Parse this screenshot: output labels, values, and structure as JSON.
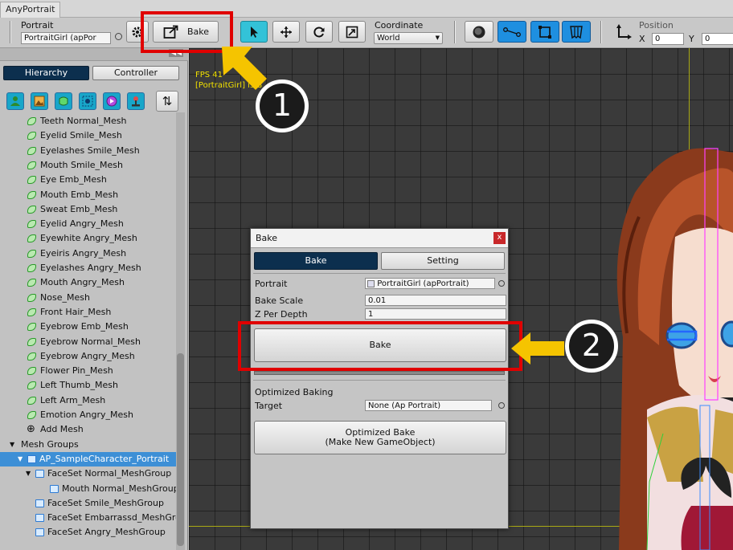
{
  "window": {
    "tab": "AnyPortrait"
  },
  "toolbar": {
    "portrait_label": "Portrait",
    "portrait_value": "PortraitGirl (apPor",
    "bake_label": "Bake",
    "coordinate_label": "Coordinate",
    "coordinate_value": "World",
    "position_label": "Position",
    "x_label": "X",
    "x_value": "0",
    "y_label": "Y",
    "y_value": "0"
  },
  "left_panel": {
    "collapse_glyph": "◀◀",
    "tabs": {
      "hierarchy": "Hierarchy",
      "controller": "Controller"
    },
    "sort_glyph": "⇅",
    "meshes": [
      "Teeth Normal_Mesh",
      "Eyelid Smile_Mesh",
      "Eyelashes Smile_Mesh",
      "Mouth Smile_Mesh",
      "Eye Emb_Mesh",
      "Mouth Emb_Mesh",
      "Sweat Emb_Mesh",
      "Eyelid Angry_Mesh",
      "Eyewhite Angry_Mesh",
      "Eyeiris Angry_Mesh",
      "Eyelashes Angry_Mesh",
      "Mouth Angry_Mesh",
      "Nose_Mesh",
      "Front Hair_Mesh",
      "Eyebrow Emb_Mesh",
      "Eyebrow Normal_Mesh",
      "Eyebrow Angry_Mesh",
      "Flower Pin_Mesh",
      "Left Thumb_Mesh",
      "Left Arm_Mesh",
      "Emotion Angry_Mesh"
    ],
    "add_mesh": "Add Mesh",
    "mesh_groups_header": "Mesh Groups",
    "groups": [
      {
        "label": "AP_SampleCharacter_Portrait",
        "indent": 1,
        "selected": true,
        "arrow": "▼"
      },
      {
        "label": "FaceSet Normal_MeshGroup",
        "indent": 2,
        "selected": false,
        "arrow": "▼"
      },
      {
        "label": "Mouth Normal_MeshGroup",
        "indent": 3,
        "selected": false,
        "arrow": ""
      },
      {
        "label": "FaceSet Smile_MeshGroup",
        "indent": 2,
        "selected": false,
        "arrow": ""
      },
      {
        "label": "FaceSet Embarrassd_MeshGroup",
        "indent": 2,
        "selected": false,
        "arrow": ""
      },
      {
        "label": "FaceSet Angry_MeshGroup",
        "indent": 2,
        "selected": false,
        "arrow": ""
      }
    ]
  },
  "canvas": {
    "fps": "FPS 41",
    "info": "[PortraitGirl] is B"
  },
  "dialog": {
    "title": "Bake",
    "close": "x",
    "tabs": {
      "bake": "Bake",
      "setting": "Setting"
    },
    "portrait_label": "Portrait",
    "portrait_value": "PortraitGirl (apPortrait)",
    "bake_scale_label": "Bake Scale",
    "bake_scale_value": "0.01",
    "z_per_depth_label": "Z Per Depth",
    "z_per_depth_value": "1",
    "bake_button": "Bake",
    "optimized_header": "Optimized Baking",
    "target_label": "Target",
    "target_value": "None (Ap Portrait)",
    "optimized_button_line1": "Optimized Bake",
    "optimized_button_line2": "(Make New GameObject)"
  },
  "annotations": {
    "step1": "1",
    "step2": "2",
    "red": "#e00000",
    "arrow": "#f5c400"
  },
  "colors": {
    "accent": "#0c2f4e",
    "selected": "#3d8fd6",
    "tool_active": "#33c2d8"
  }
}
